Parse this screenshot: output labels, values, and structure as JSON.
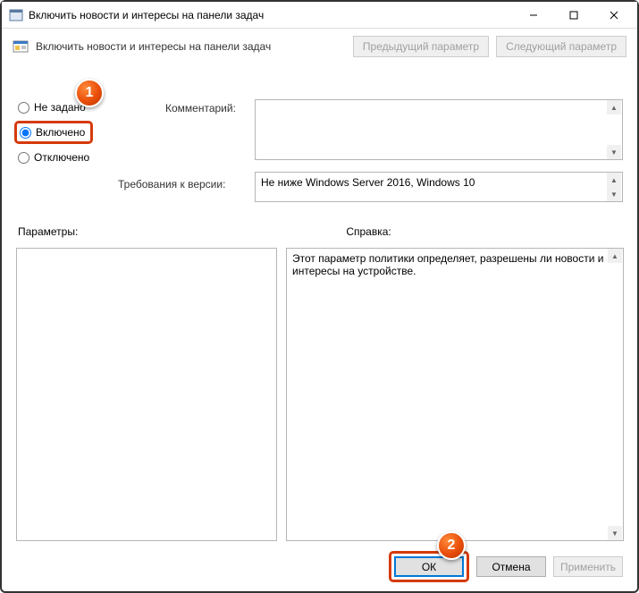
{
  "window": {
    "title": "Включить новости и интересы на панели задач"
  },
  "subheader": {
    "title": "Включить новости и интересы на панели задач"
  },
  "nav": {
    "prev": "Предыдущий параметр",
    "next": "Следующий параметр"
  },
  "radios": {
    "not_configured": "Не задано",
    "enabled": "Включено",
    "disabled": "Отключено"
  },
  "labels": {
    "comment": "Комментарий:",
    "requirements": "Требования к версии:",
    "options": "Параметры:",
    "help": "Справка:"
  },
  "fields": {
    "comment": "",
    "requirements": "Не ниже Windows Server 2016, Windows 10",
    "options": "",
    "help": "Этот параметр политики определяет, разрешены ли новости и интересы на устройстве."
  },
  "buttons": {
    "ok": "ОК",
    "cancel": "Отмена",
    "apply": "Применить"
  },
  "markers": {
    "one": "1",
    "two": "2"
  }
}
